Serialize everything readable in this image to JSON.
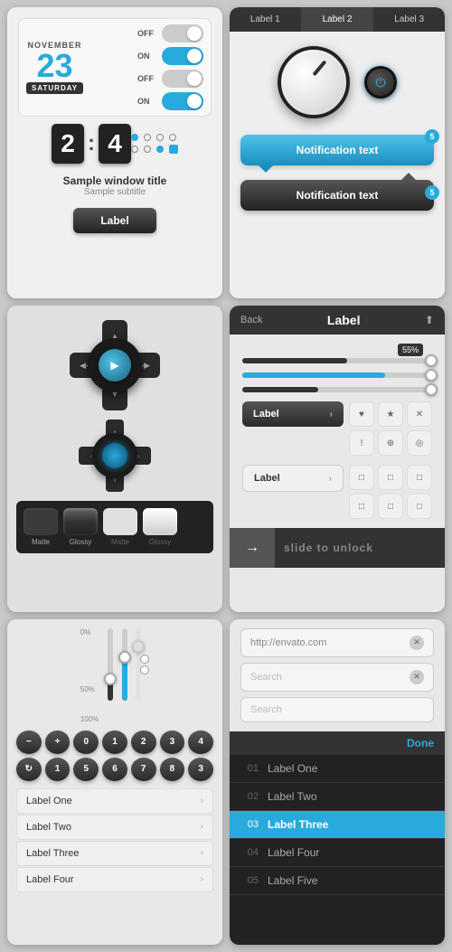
{
  "panel1": {
    "month": "NOVEMBER",
    "day": "23",
    "weekday": "SATURDAY",
    "flip1": "2",
    "flip2": "4",
    "toggle1_label": "OFF",
    "toggle2_label": "ON",
    "toggle3_label": "OFF",
    "toggle4_label": "ON",
    "window_title": "Sample window title",
    "window_subtitle": "Sample subtitle",
    "button_label": "Label"
  },
  "panel2": {
    "tab1": "Label 1",
    "tab2": "Label 2",
    "tab3": "Label 3",
    "notif_blue": "Notification text",
    "notif_dark": "Notification text",
    "badge1": "5",
    "badge2": "5"
  },
  "panel3": {
    "btn_matte1": "Matte",
    "btn_glossy1": "Glossy",
    "btn_matte2": "Matte",
    "btn_glossy2": "Glossy"
  },
  "panel4": {
    "back_label": "Back",
    "title": "Label",
    "slider_pct": "55%",
    "label1": "Label",
    "label2": "Label",
    "slide_to_unlock": "slide to unlock",
    "icons": [
      "♥",
      "★",
      "✕",
      "!",
      "⊕",
      "◎"
    ]
  },
  "panel5": {
    "slider_labels": [
      "0%",
      "50%",
      "100%"
    ],
    "numpad": [
      "−",
      "+",
      "0",
      "1",
      "2",
      "3",
      "4",
      "⟳",
      "1",
      "5",
      "6",
      "7",
      "8",
      "3"
    ],
    "list_items": [
      "Label One",
      "Label Two",
      "Label Three",
      "Label Four"
    ]
  },
  "panel6": {
    "input1_val": "http://envato.com",
    "input2_placeholder": "Search",
    "input3_placeholder": "Search",
    "picker_done": "Done",
    "picker_items": [
      {
        "num": "01",
        "text": "Label One",
        "selected": false
      },
      {
        "num": "02",
        "text": "Label Two",
        "selected": false
      },
      {
        "num": "03",
        "text": "Label Three",
        "selected": true
      },
      {
        "num": "04",
        "text": "Label Four",
        "selected": false
      },
      {
        "num": "05",
        "text": "Label Five",
        "selected": false
      }
    ]
  }
}
